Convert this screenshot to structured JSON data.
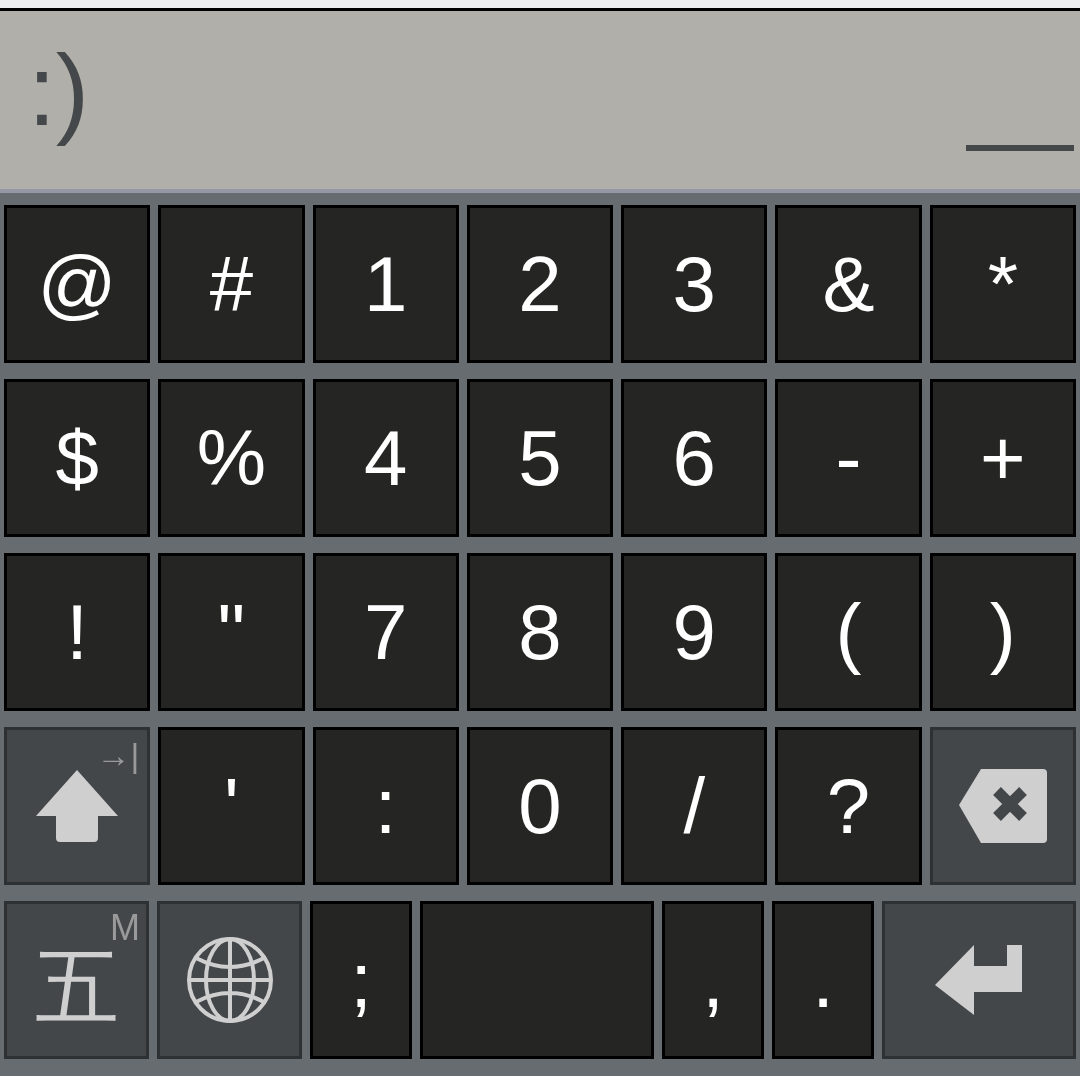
{
  "input": {
    "value": ":)",
    "composing": true
  },
  "keyboard": {
    "rows": [
      [
        {
          "kind": "char",
          "label": "@"
        },
        {
          "kind": "char",
          "label": "#"
        },
        {
          "kind": "char",
          "label": "1"
        },
        {
          "kind": "char",
          "label": "2"
        },
        {
          "kind": "char",
          "label": "3"
        },
        {
          "kind": "char",
          "label": "&"
        },
        {
          "kind": "char",
          "label": "*"
        }
      ],
      [
        {
          "kind": "char",
          "label": "$"
        },
        {
          "kind": "char",
          "label": "%"
        },
        {
          "kind": "char",
          "label": "4"
        },
        {
          "kind": "char",
          "label": "5"
        },
        {
          "kind": "char",
          "label": "6"
        },
        {
          "kind": "char",
          "label": "-"
        },
        {
          "kind": "char",
          "label": "+"
        }
      ],
      [
        {
          "kind": "char",
          "label": "!"
        },
        {
          "kind": "char",
          "label": "\""
        },
        {
          "kind": "char",
          "label": "7"
        },
        {
          "kind": "char",
          "label": "8"
        },
        {
          "kind": "char",
          "label": "9"
        },
        {
          "kind": "char",
          "label": "("
        },
        {
          "kind": "char",
          "label": ")"
        }
      ],
      [
        {
          "kind": "shift",
          "hint": "→|"
        },
        {
          "kind": "char",
          "label": "'"
        },
        {
          "kind": "char",
          "label": ":"
        },
        {
          "kind": "char",
          "label": "0"
        },
        {
          "kind": "char",
          "label": "/"
        },
        {
          "kind": "char",
          "label": "?"
        },
        {
          "kind": "delete"
        }
      ],
      [
        {
          "kind": "mode",
          "label": "五",
          "hint": "M"
        },
        {
          "kind": "globe"
        },
        {
          "kind": "narrow",
          "label": ";"
        },
        {
          "kind": "space"
        },
        {
          "kind": "narrow",
          "label": ","
        },
        {
          "kind": "narrow",
          "label": "."
        },
        {
          "kind": "enter"
        }
      ]
    ]
  }
}
